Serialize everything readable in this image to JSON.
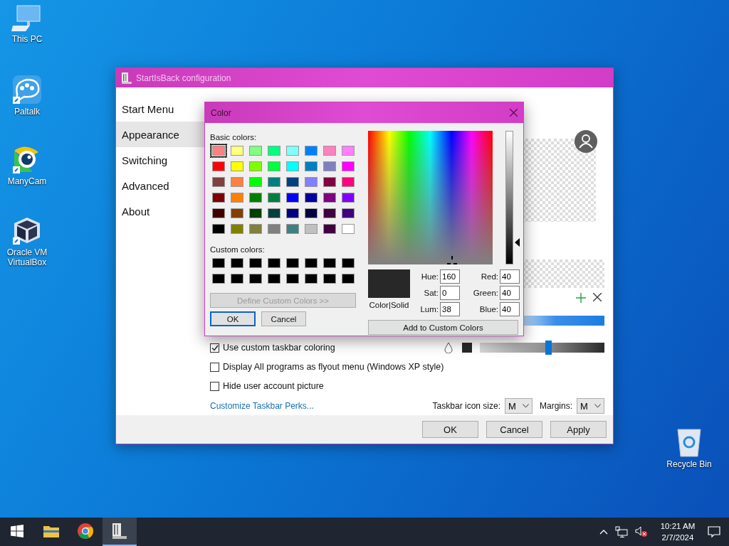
{
  "desktop_icons": [
    {
      "label": "This PC",
      "kind": "pc"
    },
    {
      "label": "Paltalk",
      "kind": "chat"
    },
    {
      "label": "ManyCam",
      "kind": "camera"
    },
    {
      "label": "Oracle VM VirtualBox",
      "kind": "cube"
    },
    {
      "label": "Recycle Bin",
      "kind": "bin"
    }
  ],
  "main_window": {
    "title": "StartIsBack configuration",
    "sidebar": [
      {
        "label": "Start Menu",
        "selected": false
      },
      {
        "label": "Appearance",
        "selected": true
      },
      {
        "label": "Switching",
        "selected": false
      },
      {
        "label": "Advanced",
        "selected": false
      },
      {
        "label": "About",
        "selected": false
      }
    ],
    "options": [
      {
        "label": "Use custom taskbar coloring",
        "checked": true
      },
      {
        "label": "Display All programs as flyout menu (Windows XP style)",
        "checked": false
      },
      {
        "label": "Hide user account picture",
        "checked": false
      }
    ],
    "taskbar_color_slider": {
      "level": 0.55
    },
    "link": "Customize Taskbar Perks...",
    "selects": [
      {
        "label": "Taskbar icon size:",
        "value": "M"
      },
      {
        "label": "Margins:",
        "value": "M"
      }
    ],
    "buttons": [
      "OK",
      "Cancel",
      "Apply"
    ]
  },
  "color_dialog": {
    "title": "Color",
    "basic_label": "Basic colors:",
    "basic_colors": [
      {
        "color": "#ff8080",
        "selected": true
      },
      {
        "color": "#ffff80",
        "selected": false
      },
      {
        "color": "#80ff80",
        "selected": false
      },
      {
        "color": "#00ff80",
        "selected": false
      },
      {
        "color": "#80ffff",
        "selected": false
      },
      {
        "color": "#0080ff",
        "selected": false
      },
      {
        "color": "#ff80c0",
        "selected": false
      },
      {
        "color": "#ff80ff",
        "selected": false
      },
      {
        "color": "#ff0000",
        "selected": false
      },
      {
        "color": "#ffff00",
        "selected": false
      },
      {
        "color": "#80ff00",
        "selected": false
      },
      {
        "color": "#00ff40",
        "selected": false
      },
      {
        "color": "#00ffff",
        "selected": false
      },
      {
        "color": "#0080c0",
        "selected": false
      },
      {
        "color": "#8080c0",
        "selected": false
      },
      {
        "color": "#ff00ff",
        "selected": false
      },
      {
        "color": "#804040",
        "selected": false
      },
      {
        "color": "#ff8040",
        "selected": false
      },
      {
        "color": "#00ff00",
        "selected": false
      },
      {
        "color": "#008080",
        "selected": false
      },
      {
        "color": "#004080",
        "selected": false
      },
      {
        "color": "#8080ff",
        "selected": false
      },
      {
        "color": "#800040",
        "selected": false
      },
      {
        "color": "#ff0080",
        "selected": false
      },
      {
        "color": "#800000",
        "selected": false
      },
      {
        "color": "#ff8000",
        "selected": false
      },
      {
        "color": "#008000",
        "selected": false
      },
      {
        "color": "#008040",
        "selected": false
      },
      {
        "color": "#0000ff",
        "selected": false
      },
      {
        "color": "#0000a0",
        "selected": false
      },
      {
        "color": "#800080",
        "selected": false
      },
      {
        "color": "#8000ff",
        "selected": false
      },
      {
        "color": "#400000",
        "selected": false
      },
      {
        "color": "#804000",
        "selected": false
      },
      {
        "color": "#004000",
        "selected": false
      },
      {
        "color": "#004040",
        "selected": false
      },
      {
        "color": "#000080",
        "selected": false
      },
      {
        "color": "#000040",
        "selected": false
      },
      {
        "color": "#400040",
        "selected": false
      },
      {
        "color": "#400080",
        "selected": false
      },
      {
        "color": "#000000",
        "selected": false
      },
      {
        "color": "#808000",
        "selected": false
      },
      {
        "color": "#808040",
        "selected": false
      },
      {
        "color": "#808080",
        "selected": false
      },
      {
        "color": "#408080",
        "selected": false
      },
      {
        "color": "#c0c0c0",
        "selected": false
      },
      {
        "color": "#400040",
        "selected": false
      },
      {
        "color": "#ffffff",
        "selected": false
      }
    ],
    "custom_label": "Custom colors:",
    "custom_colors": [
      {
        "color": "#000000"
      },
      {
        "color": "#000000"
      },
      {
        "color": "#000000"
      },
      {
        "color": "#000000"
      },
      {
        "color": "#000000"
      },
      {
        "color": "#000000"
      },
      {
        "color": "#000000"
      },
      {
        "color": "#000000"
      },
      {
        "color": "#000000"
      },
      {
        "color": "#000000"
      },
      {
        "color": "#000000"
      },
      {
        "color": "#000000"
      },
      {
        "color": "#000000"
      },
      {
        "color": "#000000"
      },
      {
        "color": "#000000"
      },
      {
        "color": "#000000"
      }
    ],
    "define_button": {
      "label": "Define Custom Colors >>",
      "disabled": true
    },
    "ok": "OK",
    "cancel": "Cancel",
    "lum_slider": {
      "level": 0.16
    },
    "preview_label": "Color|Solid",
    "fields": [
      {
        "label": "Hue:",
        "value": "160"
      },
      {
        "label": "Red:",
        "value": "40"
      },
      {
        "label": "Sat:",
        "value": "0"
      },
      {
        "label": "Green:",
        "value": "40"
      },
      {
        "label": "Lum:",
        "value": "38"
      },
      {
        "label": "Blue:",
        "value": "40"
      }
    ],
    "add_button": "Add to Custom Colors"
  },
  "taskbar": {
    "apps": [
      {
        "kind": "start",
        "selected": false
      },
      {
        "kind": "folder",
        "selected": false
      },
      {
        "kind": "browser",
        "selected": false
      },
      {
        "kind": "app",
        "selected": true
      }
    ],
    "time": "10:21 AM",
    "date": "2/7/2024"
  }
}
